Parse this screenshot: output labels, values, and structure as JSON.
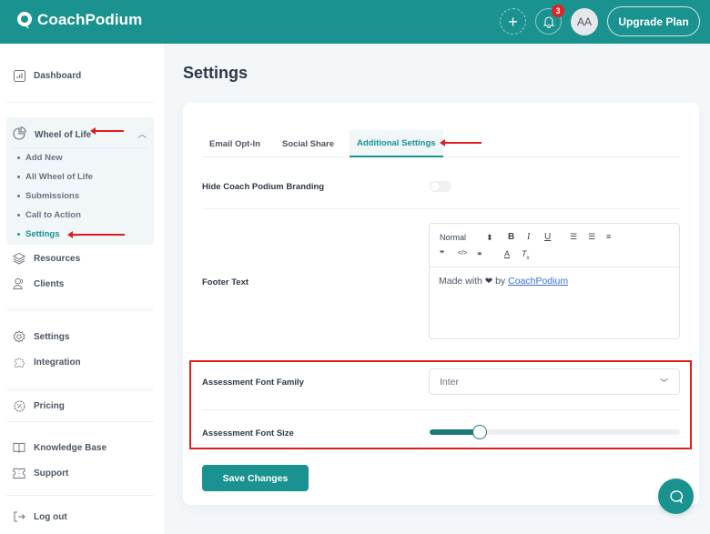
{
  "header": {
    "brand": "CoachPodium",
    "notification_count": "3",
    "avatar_initials": "AA",
    "upgrade_label": "Upgrade Plan",
    "accent_color": "#1a9290"
  },
  "sidebar": {
    "dashboard": "Dashboard",
    "wheel_of_life": {
      "label": "Wheel of Life",
      "expanded": true,
      "items": [
        {
          "label": "Add New",
          "active": false
        },
        {
          "label": "All Wheel of Life",
          "active": false
        },
        {
          "label": "Submissions",
          "active": false
        },
        {
          "label": "Call to Action",
          "active": false
        },
        {
          "label": "Settings",
          "active": true
        }
      ]
    },
    "resources": "Resources",
    "clients": "Clients",
    "settings": "Settings",
    "integration": "Integration",
    "pricing": "Pricing",
    "knowledge_base": "Knowledge Base",
    "support": "Support",
    "logout": "Log out"
  },
  "main": {
    "title": "Settings",
    "tabs": [
      {
        "label": "Email Opt-In",
        "active": false
      },
      {
        "label": "Social Share",
        "active": false
      },
      {
        "label": "Additional Settings",
        "active": true
      }
    ],
    "hide_branding": {
      "label": "Hide Coach Podium Branding",
      "enabled": false
    },
    "footer_text": {
      "label": "Footer Text",
      "toolbar": {
        "heading_select": "Normal",
        "buttons": [
          "bold",
          "italic",
          "underline",
          "ordered-list",
          "bullet-list",
          "align",
          "blockquote",
          "code",
          "link",
          "text-color",
          "clear-format"
        ]
      },
      "content_prefix": "Made with",
      "content_heart": "❤",
      "content_by": "by",
      "content_link": "CoachPodium"
    },
    "font_family": {
      "label": "Assessment Font Family",
      "value": "Inter"
    },
    "font_size": {
      "label": "Assessment Font Size",
      "value_fraction": 0.2
    },
    "save_label": "Save Changes"
  }
}
